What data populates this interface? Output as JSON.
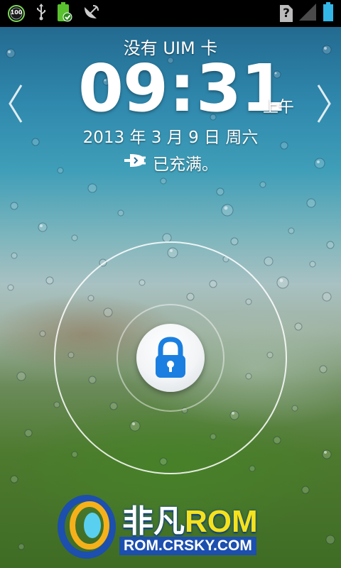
{
  "status_bar": {
    "battery_percent_badge": "100",
    "icons": [
      "battery-saver-100-icon",
      "usb-icon",
      "battery-charged-icon",
      "satellite-dish-icon",
      "no-sim-icon",
      "signal-bars-icon",
      "battery-icon"
    ],
    "no_sim_glyph": "?"
  },
  "lockscreen": {
    "carrier": "没有 UIM 卡",
    "time_hours": "09",
    "time_sep": ":",
    "time_minutes": "31",
    "ampm": "上午",
    "date": "2013 年 3 月 9 日 周六",
    "charge_status": "已充满。",
    "charge_icon": "plug-icon",
    "lock_icon": "padlock-icon"
  },
  "watermark": {
    "title_cn": "非凡",
    "title_rom": "ROM",
    "url": "ROM.CRSKY.COM"
  },
  "colors": {
    "lock_blue": "#1a7fe0",
    "battery_green": "#5ac12e",
    "battery_cyan": "#33b5e5",
    "watermark_blue": "#1c4fae",
    "watermark_yellow": "#f6e21a"
  }
}
